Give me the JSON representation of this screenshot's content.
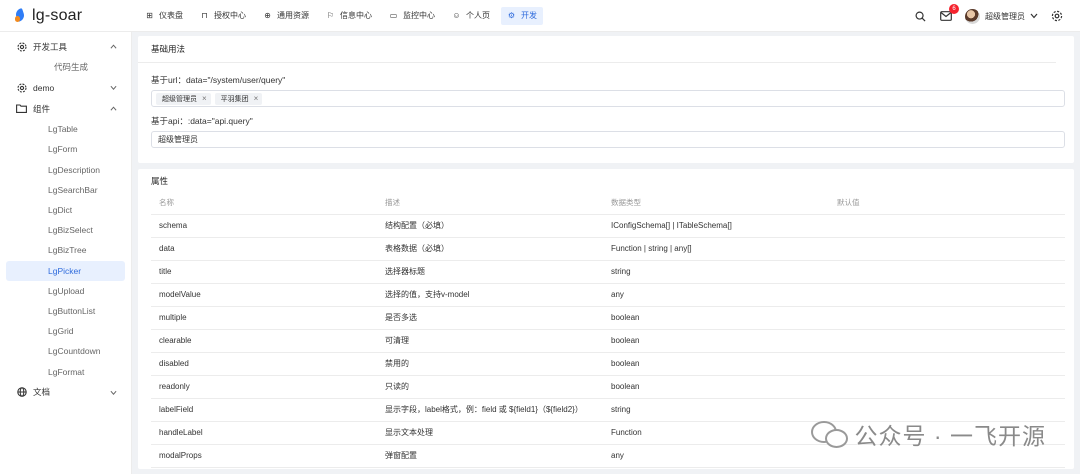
{
  "app": {
    "name": "lg-soar"
  },
  "topnav": [
    {
      "label": "仪表盘",
      "icon": "dashboard-icon",
      "glyph": "⊞",
      "active": false
    },
    {
      "label": "授权中心",
      "icon": "lock-icon",
      "glyph": "⊓",
      "active": false
    },
    {
      "label": "通用资源",
      "icon": "globe-icon",
      "glyph": "⊕",
      "active": false
    },
    {
      "label": "信息中心",
      "icon": "flag-icon",
      "glyph": "⚐",
      "active": false
    },
    {
      "label": "监控中心",
      "icon": "monitor-icon",
      "glyph": "▭",
      "active": false
    },
    {
      "label": "个人页",
      "icon": "user-icon",
      "glyph": "☺",
      "active": false
    },
    {
      "label": "开发",
      "icon": "gear-icon",
      "glyph": "⚙",
      "active": true
    }
  ],
  "header": {
    "notification_count": "6",
    "user_name": "超级管理员"
  },
  "sidebar": {
    "dev_tools": {
      "label": "开发工具",
      "items": [
        "代码生成"
      ]
    },
    "demo": {
      "label": "demo"
    },
    "components": {
      "label": "组件",
      "items": [
        "LgTable",
        "LgForm",
        "LgDescription",
        "LgSearchBar",
        "LgDict",
        "LgBizSelect",
        "LgBizTree",
        "LgPicker",
        "LgUpload",
        "LgButtonList",
        "LgGrid",
        "LgCountdown",
        "LgFormat"
      ],
      "active": "LgPicker"
    },
    "docs": {
      "label": "文档"
    }
  },
  "basic": {
    "title": "基础用法",
    "url_label": "基于url：data=\"/system/user/query\"",
    "url_tags": [
      "超级管理员",
      "平羽集团"
    ],
    "api_label": "基于api：:data=\"api.query\"",
    "api_value": "超级管理员"
  },
  "props": {
    "title": "属性",
    "headers": [
      "名称",
      "描述",
      "数据类型",
      "默认值"
    ],
    "rows": [
      [
        "schema",
        "结构配置（必填）",
        "IConfigSchema[] | ITableSchema[]",
        ""
      ],
      [
        "data",
        "表格数据（必填）",
        "Function | string | any[]",
        ""
      ],
      [
        "title",
        "选择器标题",
        "string",
        ""
      ],
      [
        "modelValue",
        "选择的值，支持v-model",
        "any",
        ""
      ],
      [
        "multiple",
        "是否多选",
        "boolean",
        ""
      ],
      [
        "clearable",
        "可清理",
        "boolean",
        ""
      ],
      [
        "disabled",
        "禁用的",
        "boolean",
        ""
      ],
      [
        "readonly",
        "只读的",
        "boolean",
        ""
      ],
      [
        "labelField",
        "显示字段，label格式，例：field 或 ${field1}（${field2}）",
        "string",
        ""
      ],
      [
        "handleLabel",
        "显示文本处理",
        "Function",
        ""
      ],
      [
        "modalProps",
        "弹窗配置",
        "any",
        ""
      ]
    ]
  },
  "watermark": {
    "text": "公众号 · 一飞开源"
  }
}
